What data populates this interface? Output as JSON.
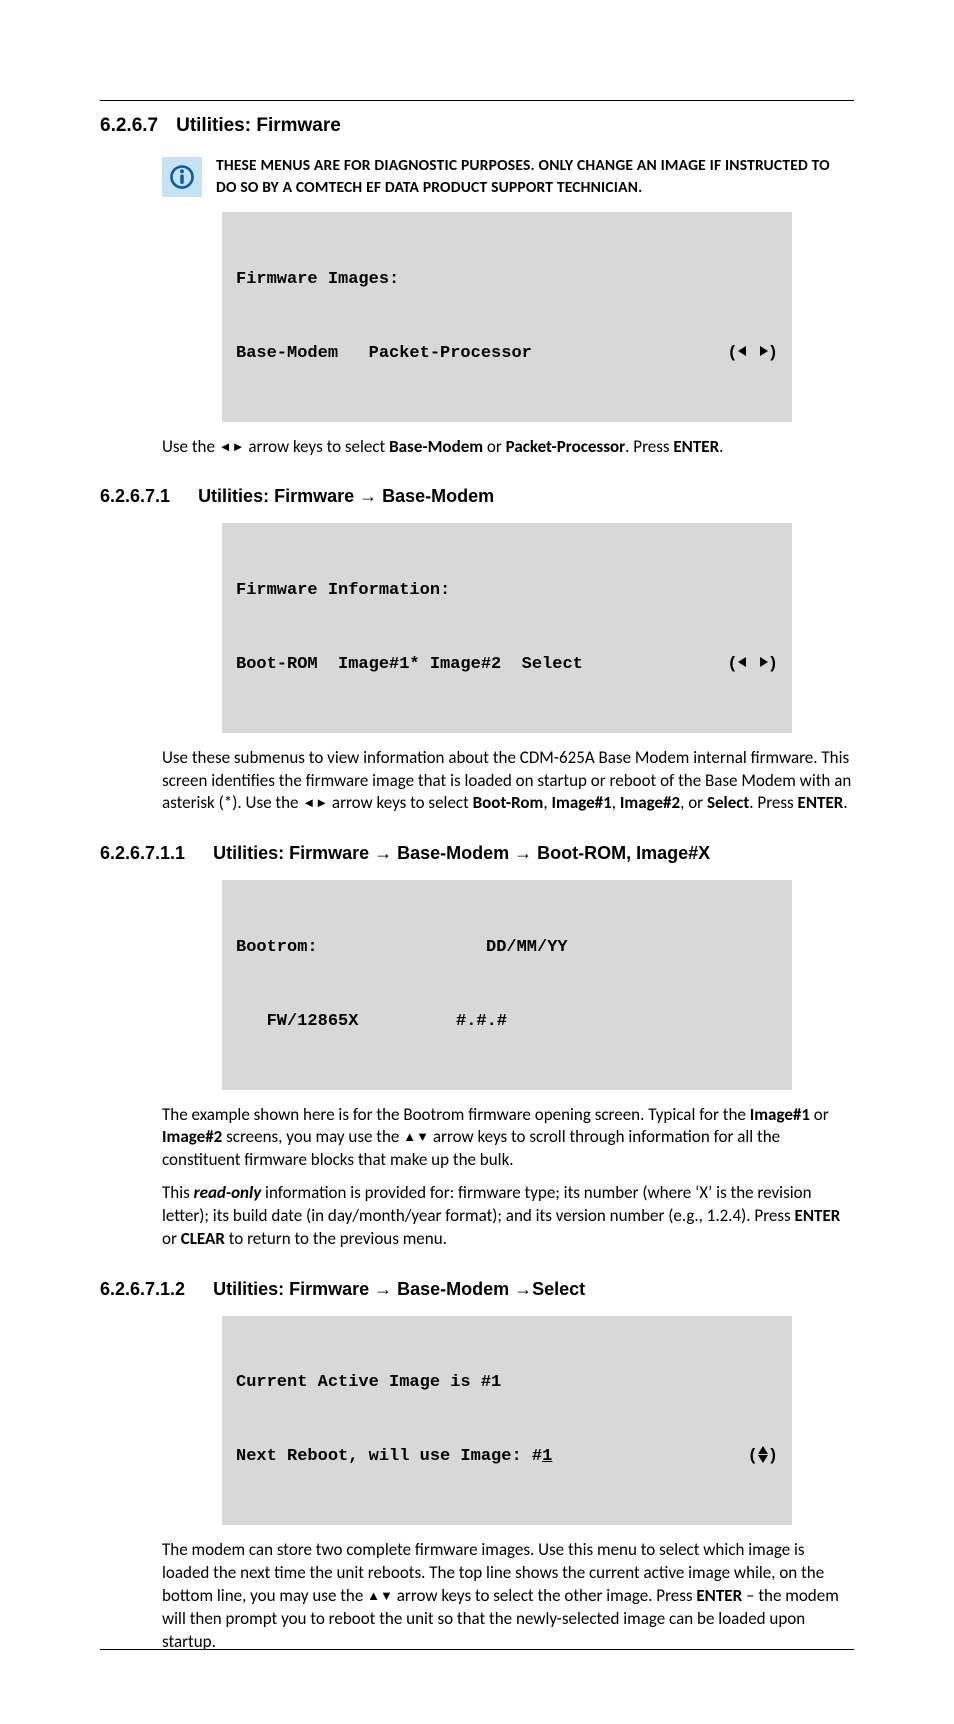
{
  "s1": {
    "num": "6.2.6.7",
    "title": "Utilities: Firmware",
    "note": "THESE MENUS ARE FOR DIAGNOSTIC PURPOSES. ONLY CHANGE AN IMAGE IF INSTRUCTED TO DO SO BY A COMTECH EF DATA PRODUCT SUPPORT TECHNICIAN.",
    "lcd_l1": "Firmware Images:",
    "lcd_l2": "Base-Modem   Packet-Processor",
    "p1a": "Use the ",
    "p1b": " arrow keys to select ",
    "p1c": "Base-Modem",
    "p1d": " or ",
    "p1e": "Packet-Processor",
    "p1f": ". Press ",
    "p1g": "ENTER",
    "p1h": "."
  },
  "s2": {
    "num": "6.2.6.7.1",
    "title": "Utilities: Firmware → Base-Modem",
    "lcd_l1": "Firmware Information:",
    "lcd_l2": "Boot-ROM  Image#1* Image#2  Select",
    "p1": "Use these submenus to view information about the CDM-625A Base Modem internal firmware. This screen identifies the firmware image that is loaded on startup or reboot of the Base Modem with an asterisk (*). Use the ",
    "p1b": " arrow keys to select ",
    "p1_bootrom": "Boot-Rom",
    "p1_c1": ", ",
    "p1_img1": "Image#1",
    "p1_c2": ", ",
    "p1_img2": "Image#2",
    "p1_c3": ", or ",
    "p1_select": "Select",
    "p1_end": ". Press ",
    "p1_enter": "ENTER",
    "p1_dot": "."
  },
  "s3": {
    "num": "6.2.6.7.1.1",
    "title": "Utilities: Firmware → Base-Modem → Boot-ROM, Image#X",
    "lcd_l1_left": "Bootrom:",
    "lcd_l1_right": "DD/MM/YY",
    "lcd_l2_left": "   FW/12865X",
    "lcd_l2_right": "#.#.#",
    "p1a": "The example shown here is for the Bootrom firmware opening screen. Typical for the ",
    "p1_img1": "Image#1",
    "p1b": " or ",
    "p1_img2": "Image#2",
    "p1c": " screens, you may use the ",
    "p1d": " arrow keys to scroll through information for all the constituent firmware blocks that make up the bulk.",
    "p2a": "This ",
    "p2_ro": "read-only",
    "p2b": " information is provided for: firmware type; its number (where ‘X’ is the revision letter); its build date (in day/month/year format); and its version number (e.g., 1.2.4). Press ",
    "p2_enter": "ENTER",
    "p2c": " or ",
    "p2_clear": "CLEAR",
    "p2d": " to return to the previous menu."
  },
  "s4": {
    "num": "6.2.6.7.1.2",
    "title": "Utilities: Firmware → Base-Modem →Select",
    "lcd_l1": "Current Active Image is #1",
    "lcd_l2a": "Next Reboot, will use Image: #",
    "lcd_l2b": "1",
    "p1a": "The modem can store two complete firmware images. Use this menu to select which image is loaded the next time the unit reboots. The top line shows the current active image while, on the bottom line, you may use the ",
    "p1b": " arrow keys to select the other image. Press ",
    "p1_enter": "ENTER",
    "p1c": " – the modem will then prompt you to reboot the unit so that the newly-selected image can be loaded upon startup."
  }
}
